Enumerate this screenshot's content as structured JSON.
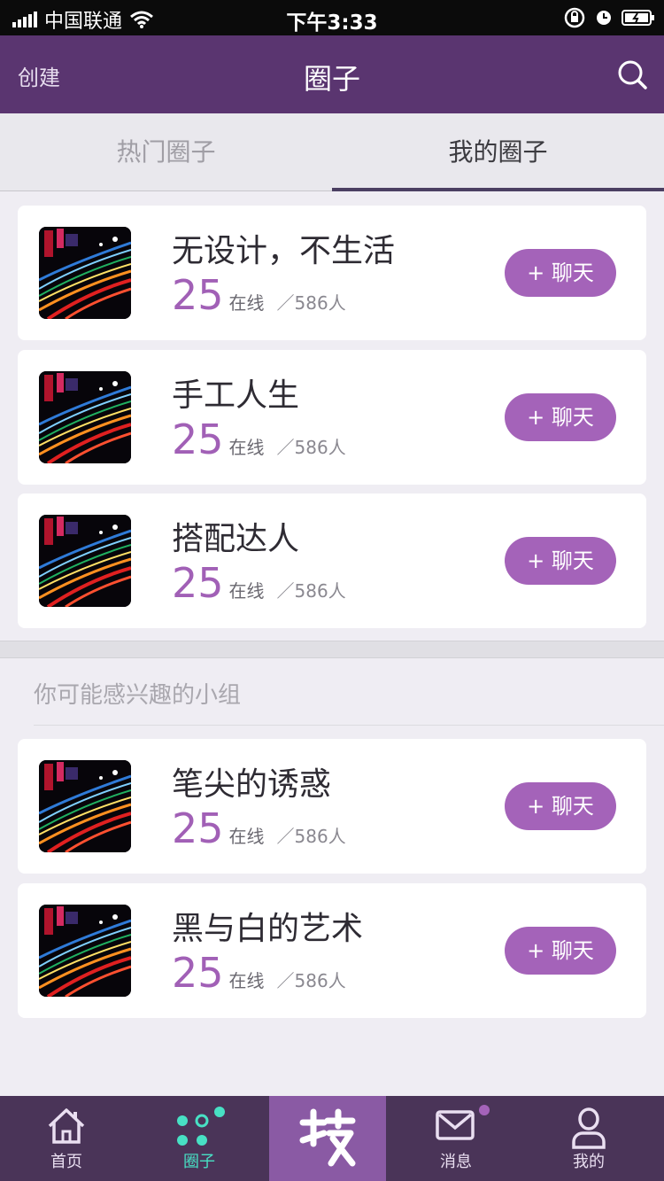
{
  "status_bar": {
    "carrier": "中国联通",
    "time": "下午3:33"
  },
  "nav": {
    "left": "创建",
    "title": "圈子",
    "right_icon": "search-icon"
  },
  "tabs": [
    {
      "label": "热门圈子",
      "active": false
    },
    {
      "label": "我的圈子",
      "active": true
    }
  ],
  "my_groups": [
    {
      "name": "无设计，不生活",
      "online": "25",
      "online_label": "在线",
      "total": "／586人",
      "button": "+ 聊天"
    },
    {
      "name": "手工人生",
      "online": "25",
      "online_label": "在线",
      "total": "／586人",
      "button": "+ 聊天"
    },
    {
      "name": "搭配达人",
      "online": "25",
      "online_label": "在线",
      "total": "／586人",
      "button": "+ 聊天"
    }
  ],
  "suggest_title": "你可能感兴趣的小组",
  "suggested_groups": [
    {
      "name": "笔尖的诱惑",
      "online": "25",
      "online_label": "在线",
      "total": "／586人",
      "button": "+ 聊天"
    },
    {
      "name": "黑与白的艺术",
      "online": "25",
      "online_label": "在线",
      "total": "／586人",
      "button": "+ 聊天"
    }
  ],
  "tabbar": [
    {
      "label": "首页",
      "icon": "home-icon"
    },
    {
      "label": "圈子",
      "icon": "circles-icon",
      "active": true
    },
    {
      "label": "",
      "icon": "center-logo-icon"
    },
    {
      "label": "消息",
      "icon": "mail-icon"
    },
    {
      "label": "我的",
      "icon": "user-icon"
    }
  ],
  "colors": {
    "nav": "#5a3570",
    "accent": "#a463b9",
    "tabbar": "#4a3458",
    "active_tab_text": "#48e0c4"
  }
}
